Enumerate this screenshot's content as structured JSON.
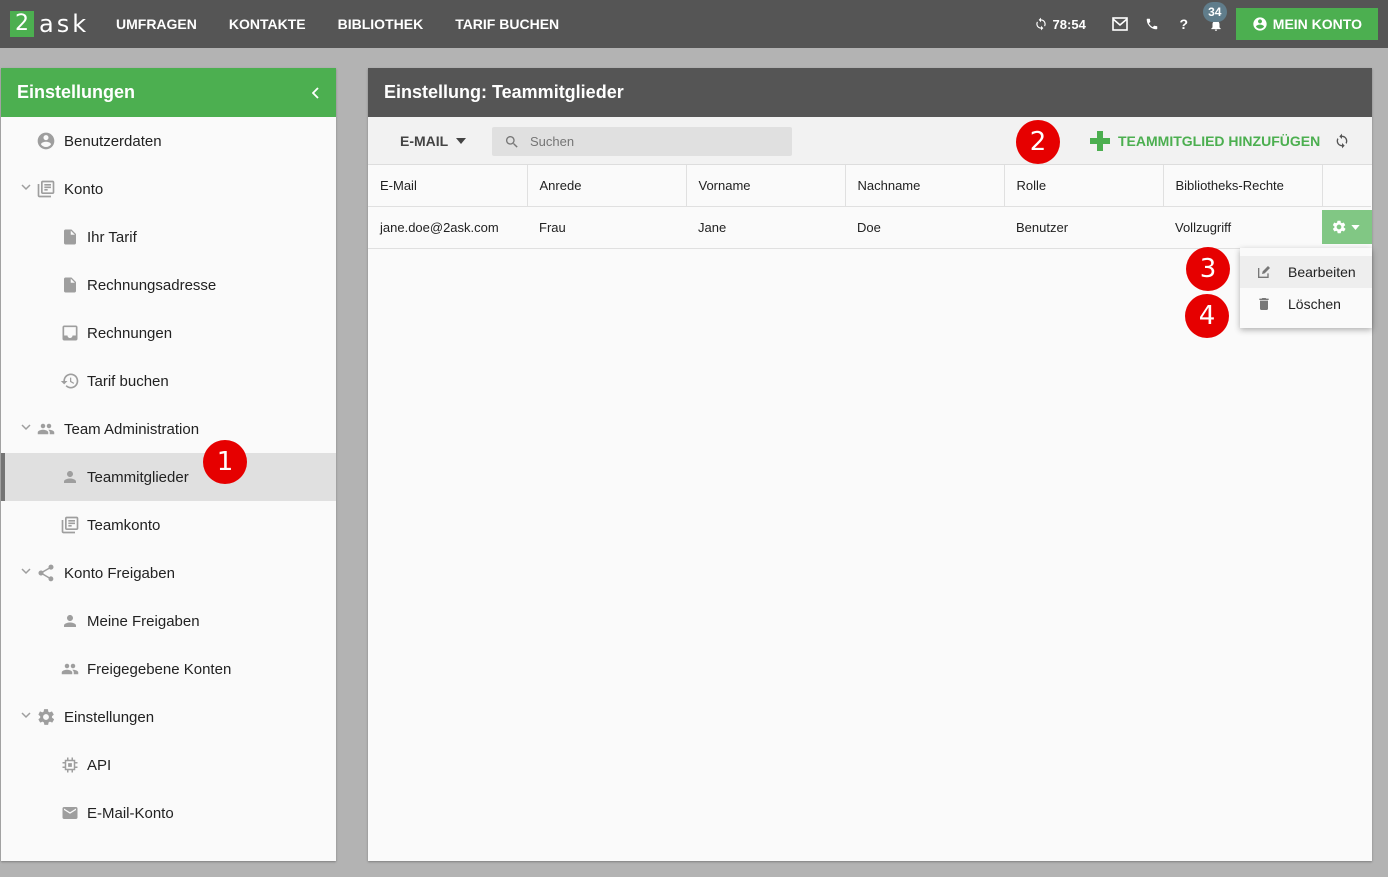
{
  "topbar": {
    "logo_digit": "2",
    "logo_text": "ask",
    "nav": [
      "UMFRAGEN",
      "KONTAKTE",
      "BIBLIOTHEK",
      "TARIF BUCHEN"
    ],
    "timer": "78:54",
    "notification_count": "34",
    "account_label": "MEIN KONTO"
  },
  "sidebar": {
    "title": "Einstellungen",
    "items": [
      {
        "label": "Benutzerdaten",
        "icon": "account-circle-icon"
      },
      {
        "label": "Konto",
        "icon": "library-books-icon"
      },
      {
        "label": "Ihr Tarif",
        "icon": "document-icon"
      },
      {
        "label": "Rechnungsadresse",
        "icon": "document-icon"
      },
      {
        "label": "Rechnungen",
        "icon": "inbox-icon"
      },
      {
        "label": "Tarif buchen",
        "icon": "restore-icon"
      },
      {
        "label": "Team Administration",
        "icon": "people-icon"
      },
      {
        "label": "Teammitglieder",
        "icon": "person-icon"
      },
      {
        "label": "Teamkonto",
        "icon": "library-books-icon"
      },
      {
        "label": "Konto Freigaben",
        "icon": "share-icon"
      },
      {
        "label": "Meine Freigaben",
        "icon": "person-icon"
      },
      {
        "label": "Freigegebene Konten",
        "icon": "people-icon"
      },
      {
        "label": "Einstellungen",
        "icon": "gear-icon"
      },
      {
        "label": "API",
        "icon": "chip-icon"
      },
      {
        "label": "E-Mail-Konto",
        "icon": "email-icon"
      }
    ]
  },
  "main": {
    "title": "Einstellung: Teammitglieder",
    "filter_label": "E-MAIL",
    "search_placeholder": "Suchen",
    "add_label": "TEAMMITGLIED HINZUFÜGEN",
    "columns": [
      "E-Mail",
      "Anrede",
      "Vorname",
      "Nachname",
      "Rolle",
      "Bibliotheks-Rechte"
    ],
    "rows": [
      [
        "jane.doe@2ask.com",
        "Frau",
        "Jane",
        "Doe",
        "Benutzer",
        "Vollzugriff"
      ]
    ],
    "row_menu": [
      "Bearbeiten",
      "Löschen"
    ]
  },
  "markers": [
    "1",
    "2",
    "3",
    "4"
  ],
  "colors": {
    "brand_green": "#4caf50",
    "header_dark": "#555555",
    "marker_red": "#e60000"
  }
}
